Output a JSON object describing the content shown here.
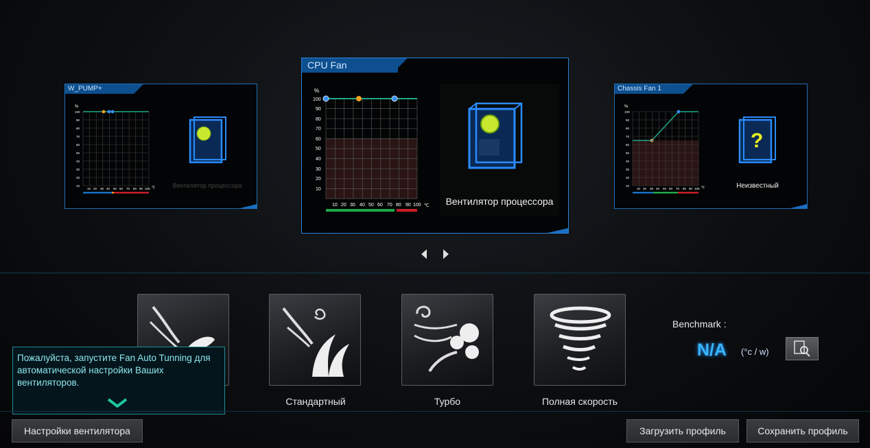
{
  "fans": [
    {
      "title": "W_PUMP+",
      "device_label": "Вентилятор процессора",
      "percent_unit": "%",
      "temp_unit": "℃",
      "y_ticks": [
        "100",
        "90",
        "80",
        "70",
        "60",
        "50",
        "40",
        "30",
        "20",
        "10"
      ],
      "x_ticks": [
        "10",
        "20",
        "30",
        "40",
        "50",
        "60",
        "70",
        "80",
        "90",
        "100"
      ]
    },
    {
      "title": "CPU Fan",
      "device_label": "Вентилятор процессора",
      "percent_unit": "%",
      "temp_unit": "℃",
      "y_ticks": [
        "100",
        "90",
        "80",
        "70",
        "60",
        "50",
        "40",
        "30",
        "20",
        "10"
      ],
      "x_ticks": [
        "10",
        "20",
        "30",
        "40",
        "50",
        "60",
        "70",
        "80",
        "90",
        "100"
      ]
    },
    {
      "title": "Chassis Fan 1",
      "device_label": "Неизвестный",
      "percent_unit": "%",
      "temp_unit": "℃",
      "y_ticks": [
        "100",
        "90",
        "80",
        "70",
        "60",
        "50",
        "40",
        "30",
        "20",
        "10"
      ],
      "x_ticks": [
        "10",
        "20",
        "30",
        "40",
        "50",
        "60",
        "70",
        "80",
        "90",
        "100"
      ]
    }
  ],
  "modes": [
    {
      "label": "",
      "icon": "silent-leaf-icon"
    },
    {
      "label": "Стандартный",
      "icon": "standard-wind-icon"
    },
    {
      "label": "Турбо",
      "icon": "turbo-wind-icon"
    },
    {
      "label": "Полная скорость",
      "icon": "tornado-icon"
    }
  ],
  "benchmark": {
    "label": "Benchmark :",
    "value": "N/A",
    "unit": "(°c / w)",
    "icon": "benchmark-search-icon"
  },
  "tooltip": {
    "text": "Пожалуйста, запустите Fan Auto Tunning для автоматической настройки Ваших вентиляторов."
  },
  "buttons": {
    "fan_settings": "Настройки вентилятора",
    "load_profile": "Загрузить профиль",
    "save_profile": "Сохранить профиль"
  },
  "colors": {
    "accent_blue": "#1f6fb5",
    "curve": "#1fa98a",
    "green_bar": "#1fa84a",
    "red_bar": "#c81e28",
    "na_color": "#38b6ff"
  }
}
